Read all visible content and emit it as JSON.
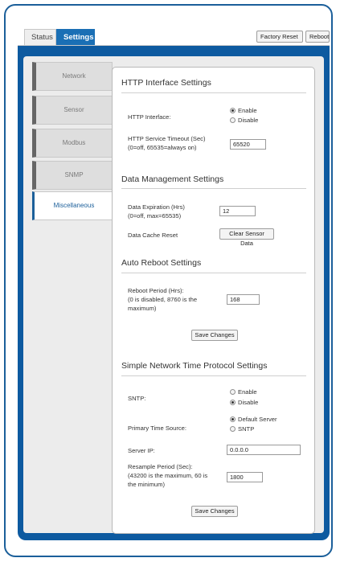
{
  "tabs": {
    "status": "Status",
    "settings": "Settings"
  },
  "toolbar": {
    "factory_reset": "Factory Reset",
    "reboot": "Reboot"
  },
  "sidebar": {
    "items": [
      {
        "label": "Network"
      },
      {
        "label": "Sensor"
      },
      {
        "label": "Modbus"
      },
      {
        "label": "SNMP"
      },
      {
        "label": "Miscellaneous"
      }
    ]
  },
  "http": {
    "title": "HTTP Interface Settings",
    "interface_label": "HTTP Interface:",
    "enable": "Enable",
    "disable": "Disable",
    "selected": "Enable",
    "timeout_label_1": "HTTP Service Timeout (Sec)",
    "timeout_label_2": "(0=off, 65535=always on)",
    "timeout_value": "65520"
  },
  "data_mgmt": {
    "title": "Data Management Settings",
    "expiration_label_1": "Data Expiration (Hrs)",
    "expiration_label_2": "(0=off, max=65535)",
    "expiration_value": "12",
    "cache_label": "Data Cache Reset",
    "clear_button": "Clear Sensor Data"
  },
  "auto_reboot": {
    "title": "Auto Reboot Settings",
    "period_label_1": "Reboot Period (Hrs):",
    "period_label_2": "(0 is disabled, 8760 is the",
    "period_label_3": "maximum)",
    "period_value": "168",
    "save_button": "Save Changes"
  },
  "sntp": {
    "title": "Simple Network Time Protocol Settings",
    "sntp_label": "SNTP:",
    "enable": "Enable",
    "disable": "Disable",
    "selected": "Disable",
    "source_label": "Primary Time Source:",
    "source_default": "Default Server",
    "source_sntp": "SNTP",
    "source_selected": "Default Server",
    "server_ip_label": "Server IP:",
    "server_ip_value": "0.0.0.0",
    "resample_label_1": "Resample Period (Sec):",
    "resample_label_2": "(43200 is the maximum, 60 is",
    "resample_label_3": "the minimum)",
    "resample_value": "1800",
    "save_button": "Save Changes"
  },
  "colors": {
    "accent": "#1a6fb5",
    "panel": "#0d5aa0"
  }
}
